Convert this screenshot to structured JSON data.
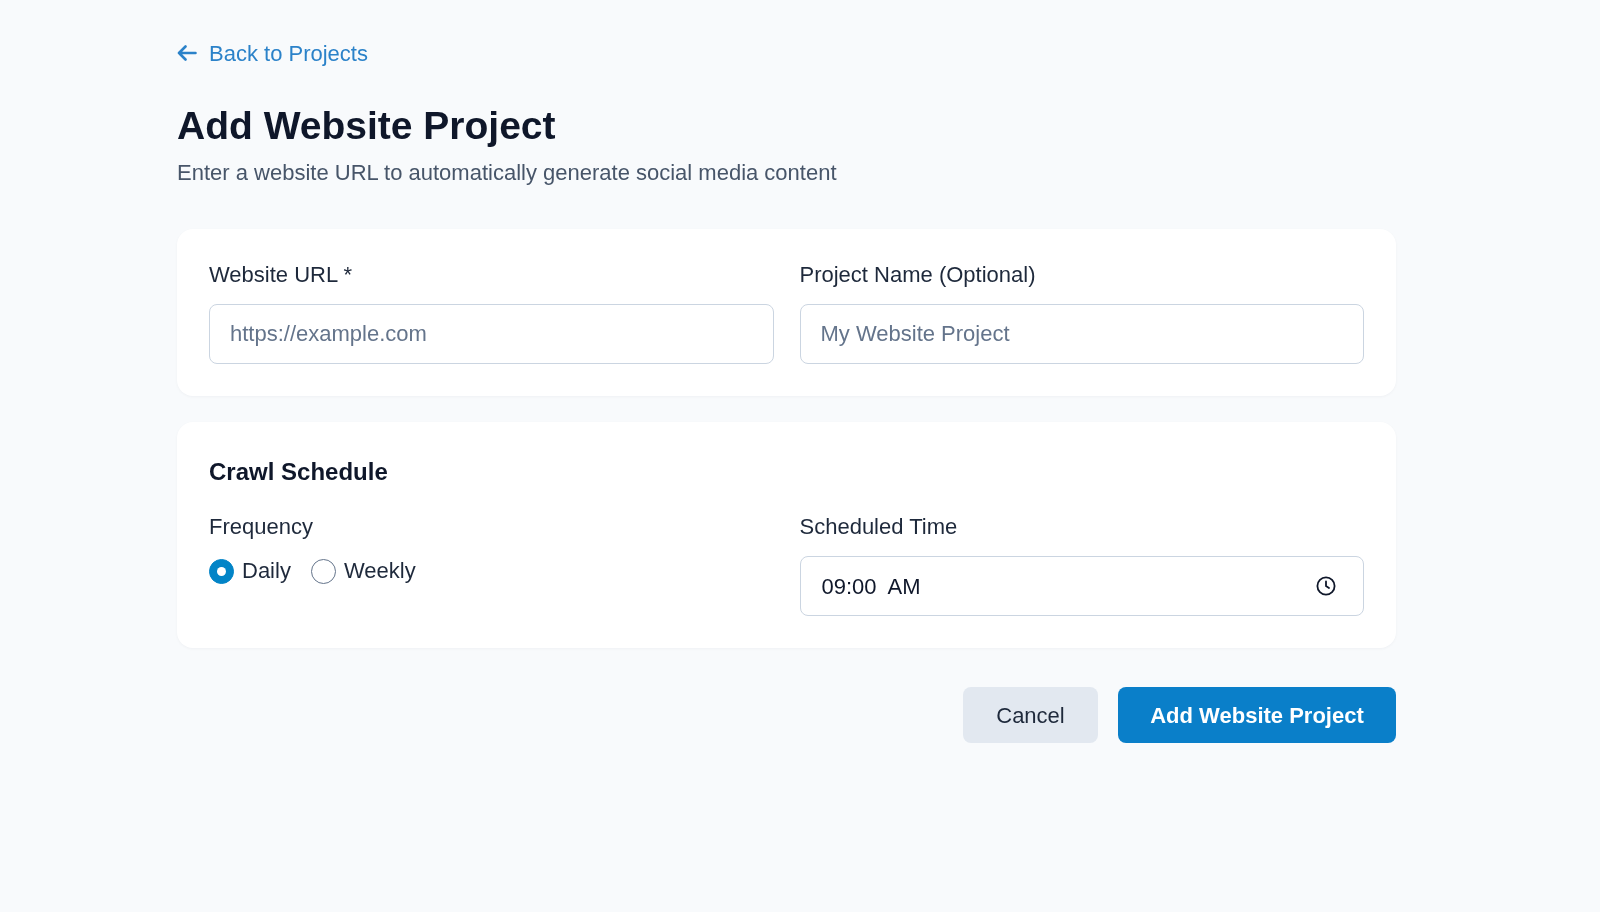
{
  "back_link": {
    "label": "Back to Projects"
  },
  "header": {
    "title": "Add Website Project",
    "subtitle": "Enter a website URL to automatically generate social media content"
  },
  "project_fields": [
    {
      "label": "Website URL *",
      "placeholder": "https://example.com"
    },
    {
      "label": "Project Name (Optional)",
      "placeholder": "My Website Project"
    }
  ],
  "crawl_schedule": {
    "title": "Crawl Schedule",
    "frequency": {
      "label": "Frequency",
      "options": [
        {
          "label": "Daily",
          "selected": true
        },
        {
          "label": "Weekly",
          "selected": false
        }
      ]
    },
    "scheduled_time": {
      "label": "Scheduled Time",
      "value": "09:00  AM"
    }
  },
  "buttons": [
    {
      "label": "Cancel",
      "kind": "secondary"
    },
    {
      "label": "Add Website Project",
      "kind": "primary"
    }
  ]
}
